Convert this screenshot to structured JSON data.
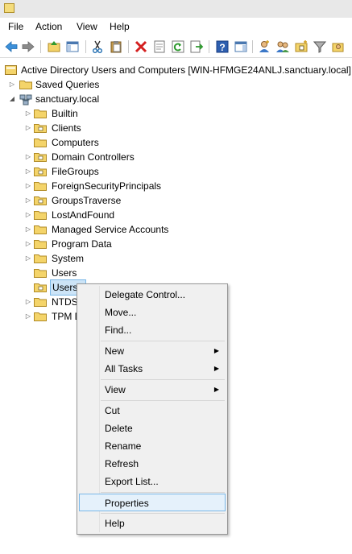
{
  "menubar": {
    "items": [
      "File",
      "Action",
      "View",
      "Help"
    ]
  },
  "toolbar": {
    "buttons": [
      "back-icon",
      "forward-icon",
      "up-folder-icon",
      "show-hide-console-tree-icon",
      "cut-icon",
      "paste-icon",
      "delete-icon",
      "properties-icon",
      "refresh-icon",
      "export-list-icon",
      "help-icon",
      "show-action-pane-icon",
      "new-user-icon",
      "new-group-icon",
      "new-ou-icon",
      "filter-icon",
      "add-to-group-icon"
    ]
  },
  "tree": {
    "root": "Active Directory Users and Computers [WIN-HFMGE24ANLJ.sanctuary.local]",
    "saved_queries": "Saved Queries",
    "domain": "sanctuary.local",
    "children": [
      "Builtin",
      "Clients",
      "Computers",
      "Domain Controllers",
      "FileGroups",
      "ForeignSecurityPrincipals",
      "GroupsTraverse",
      "LostAndFound",
      "Managed Service Accounts",
      "Program Data",
      "System",
      "Users",
      "UsersT",
      "NTDS",
      "TPM D"
    ]
  },
  "context_menu": {
    "items": [
      "Delegate Control...",
      "Move...",
      "Find...",
      "New",
      "All Tasks",
      "View",
      "Cut",
      "Delete",
      "Rename",
      "Refresh",
      "Export List...",
      "Properties",
      "Help"
    ],
    "highlighted": "Properties"
  },
  "colors": {
    "selection_fill": "#cce4f7",
    "selection_border": "#7ab8e8",
    "menu_background": "#f0f0f0",
    "folder_yellow": "#f4d46a"
  }
}
